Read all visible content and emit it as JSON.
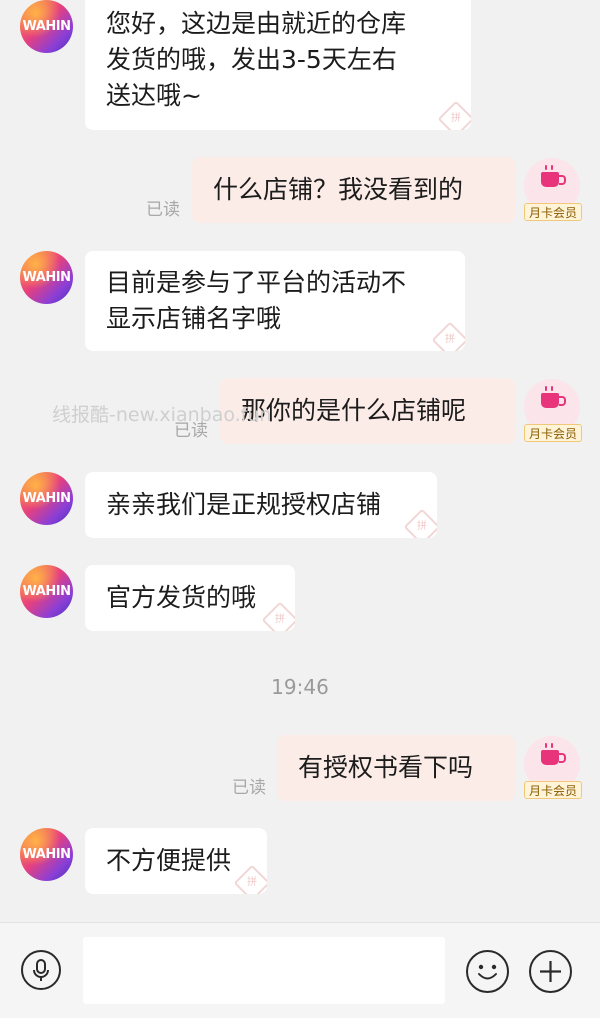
{
  "watermark": "线报酷-new.xianbao.fun",
  "read_label": "已读",
  "shop_avatar_text": "WAHIN",
  "member_badge": "月卡会员",
  "bubble_stamp": "拼",
  "messages": [
    {
      "from": "shop",
      "text": "您好，这边是由就近的仓库\n发货的哦，发出3-5天左右\n送达哦~"
    },
    {
      "from": "me",
      "text": "什么店铺？我没看到的",
      "status": "已读"
    },
    {
      "from": "shop",
      "text": "目前是参与了平台的活动不\n显示店铺名字哦"
    },
    {
      "from": "me",
      "text": "那你的是什么店铺呢",
      "status": "已读"
    },
    {
      "from": "shop",
      "text": "亲亲我们是正规授权店铺"
    },
    {
      "from": "shop",
      "text": "官方发货的哦"
    },
    {
      "from": "me",
      "text": "有授权书看下吗",
      "status": "已读"
    },
    {
      "from": "shop",
      "text": "不方便提供"
    }
  ],
  "timestamp": "19:46",
  "composer": {
    "voice_icon": "microphone-icon",
    "emoji_icon": "smiley-icon",
    "plus_icon": "plus-icon",
    "input_value": ""
  }
}
